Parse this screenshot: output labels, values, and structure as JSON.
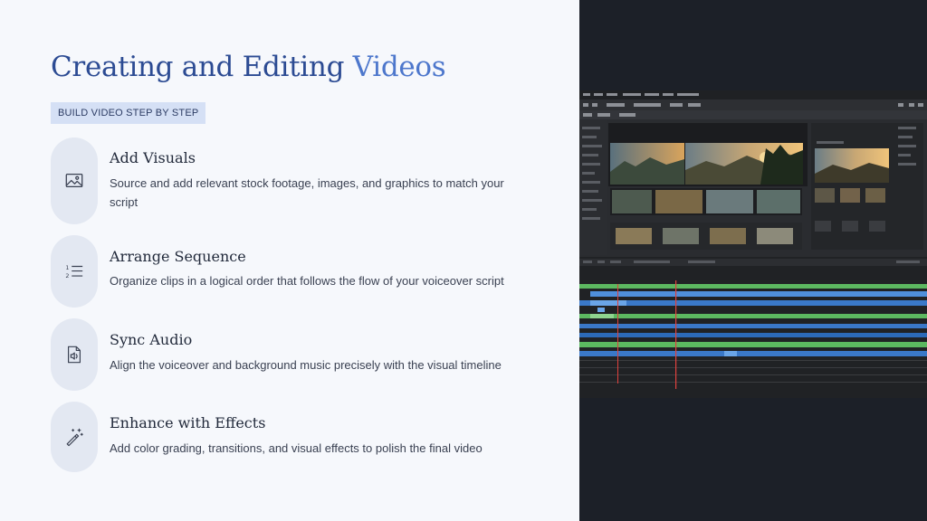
{
  "slide": {
    "title_main": "Creating and Editing ",
    "title_accent": "Videos",
    "badge": "BUILD VIDEO STEP BY STEP",
    "steps": [
      {
        "icon": "image-icon",
        "heading": "Add Visuals",
        "description": "Source and add relevant stock footage, images, and graphics to match your script"
      },
      {
        "icon": "numbered-list-icon",
        "heading": "Arrange Sequence",
        "description": "Organize clips in a logical order that follows the flow of your voiceover script"
      },
      {
        "icon": "audio-file-icon",
        "heading": "Sync Audio",
        "description": "Align the voiceover and background music precisely with the visual timeline"
      },
      {
        "icon": "magic-wand-icon",
        "heading": "Enhance with Effects",
        "description": "Add color grading, transitions, and visual effects to polish the final video"
      }
    ]
  },
  "colors": {
    "title": "#2c4b93",
    "title_accent": "#4d77cc",
    "badge_bg": "#d5e0f5",
    "pill_bg": "#e3e8f2",
    "track_green": "#5cb860",
    "track_blue": "#3a78c8",
    "playhead": "#e0413d"
  },
  "editor_photo": {
    "description_icon": "video-editor-screenshot"
  }
}
